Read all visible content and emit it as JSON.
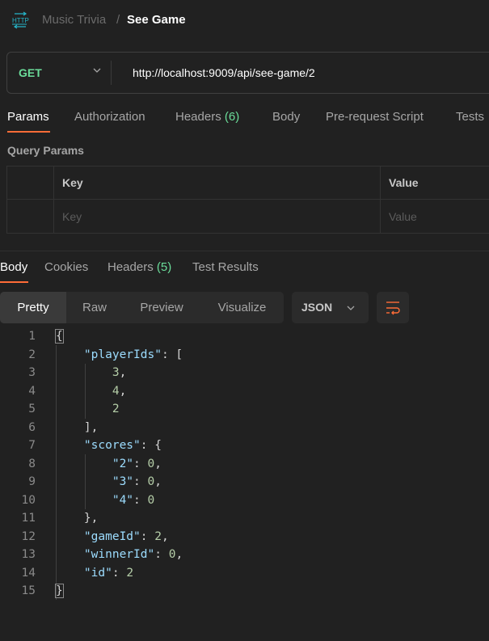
{
  "header": {
    "icon": "http-icon",
    "breadcrumb": {
      "parent": "Music Trivia",
      "separator": "/",
      "current": "See Game"
    }
  },
  "request": {
    "method": "GET",
    "method_color": "#6bdd9a",
    "url": "http://localhost:9009/api/see-game/2",
    "tabs": [
      {
        "label": "Params",
        "count": null,
        "active": true
      },
      {
        "label": "Authorization",
        "count": null,
        "active": false
      },
      {
        "label": "Headers",
        "count": "(6)",
        "active": false
      },
      {
        "label": "Body",
        "count": null,
        "active": false
      },
      {
        "label": "Pre-request Script",
        "count": null,
        "active": false
      },
      {
        "label": "Tests",
        "count": null,
        "active": false
      }
    ],
    "query_params": {
      "title": "Query Params",
      "columns": [
        "Key",
        "Value"
      ],
      "placeholders": {
        "key": "Key",
        "value": "Value"
      }
    }
  },
  "response": {
    "tabs": [
      {
        "label": "Body",
        "count": null,
        "active": true
      },
      {
        "label": "Cookies",
        "count": null,
        "active": false
      },
      {
        "label": "Headers",
        "count": "(5)",
        "active": false
      },
      {
        "label": "Test Results",
        "count": null,
        "active": false
      }
    ],
    "view_modes": [
      "Pretty",
      "Raw",
      "Preview",
      "Visualize"
    ],
    "active_view": "Pretty",
    "format": "JSON",
    "accent_color": "#ff6c37",
    "body_lines": [
      "{",
      "    \"playerIds\": [",
      "        3,",
      "        4,",
      "        2",
      "    ],",
      "    \"scores\": {",
      "        \"2\": 0,",
      "        \"3\": 0,",
      "        \"4\": 0",
      "    },",
      "    \"gameId\": 2,",
      "    \"winnerId\": 0,",
      "    \"id\": 2",
      "}"
    ]
  }
}
